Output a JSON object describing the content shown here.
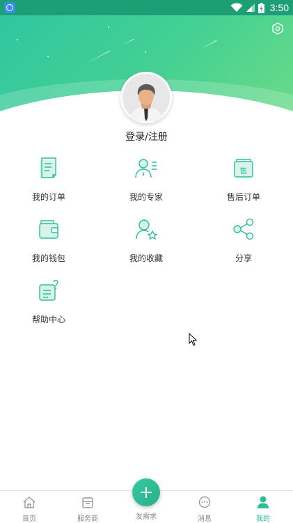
{
  "status_bar": {
    "time": "3:50"
  },
  "profile": {
    "login_label": "登录/注册"
  },
  "menu": [
    {
      "label": "我的订单",
      "icon": "order-list-icon"
    },
    {
      "label": "我的专家",
      "icon": "expert-icon"
    },
    {
      "label": "售后订单",
      "icon": "after-sales-icon"
    },
    {
      "label": "我的钱包",
      "icon": "wallet-icon"
    },
    {
      "label": "我的收藏",
      "icon": "favorite-icon"
    },
    {
      "label": "分享",
      "icon": "share-icon"
    },
    {
      "label": "帮助中心",
      "icon": "help-icon"
    }
  ],
  "tabbar": {
    "home": "首页",
    "providers": "服务商",
    "post": "发需求",
    "messages": "消息",
    "mine": "我的"
  },
  "colors": {
    "accent": "#2cbf94",
    "header_start": "#2fc6a0",
    "header_end": "#6edb86"
  }
}
